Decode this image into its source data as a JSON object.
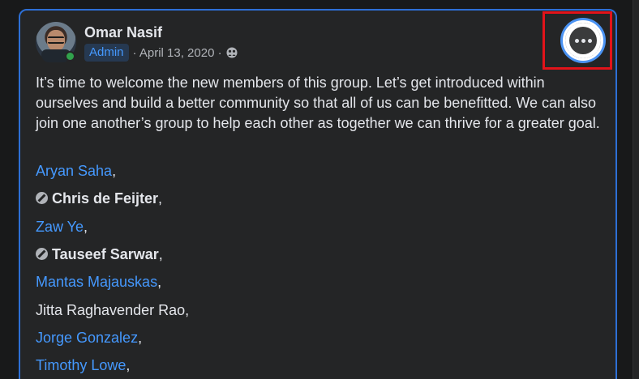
{
  "post": {
    "author": {
      "name": "Omar Nasif",
      "role_badge": "Admin",
      "online": true
    },
    "meta": {
      "date": "· April 13, 2020 ·",
      "audience_icon": "group-audience-icon"
    },
    "more_button": {
      "icon": "more-options-icon",
      "highlighted": true
    },
    "text": "It’s time to welcome the new members of this group. Let’s get introduced within ourselves and build a better community so that all of us can be benefitted. We can also join one another’s group to help each other as together we can thrive for a greater goal.",
    "mentions": [
      {
        "name": "Aryan Saha",
        "type": "link",
        "suffix": ","
      },
      {
        "name": "Chris de Feijter",
        "type": "deactivated",
        "suffix": ","
      },
      {
        "name": "Zaw Ye",
        "type": "link",
        "suffix": ","
      },
      {
        "name": "Tauseef Sarwar",
        "type": "deactivated",
        "suffix": ","
      },
      {
        "name": "Mantas Majauskas",
        "type": "link",
        "suffix": ","
      },
      {
        "name": "Jitta Raghavender Rao",
        "type": "plain",
        "suffix": ","
      },
      {
        "name": "Jorge Gonzalez",
        "type": "link",
        "suffix": ","
      },
      {
        "name": "Timothy Lowe",
        "type": "link",
        "suffix": ","
      }
    ]
  },
  "colors": {
    "background": "#18191a",
    "card": "#242526",
    "link": "#4599ff",
    "text": "#e4e6eb",
    "secondary_text": "#b0b3b8",
    "highlight_box": "#e2131a",
    "card_border": "#2d6fd6"
  }
}
